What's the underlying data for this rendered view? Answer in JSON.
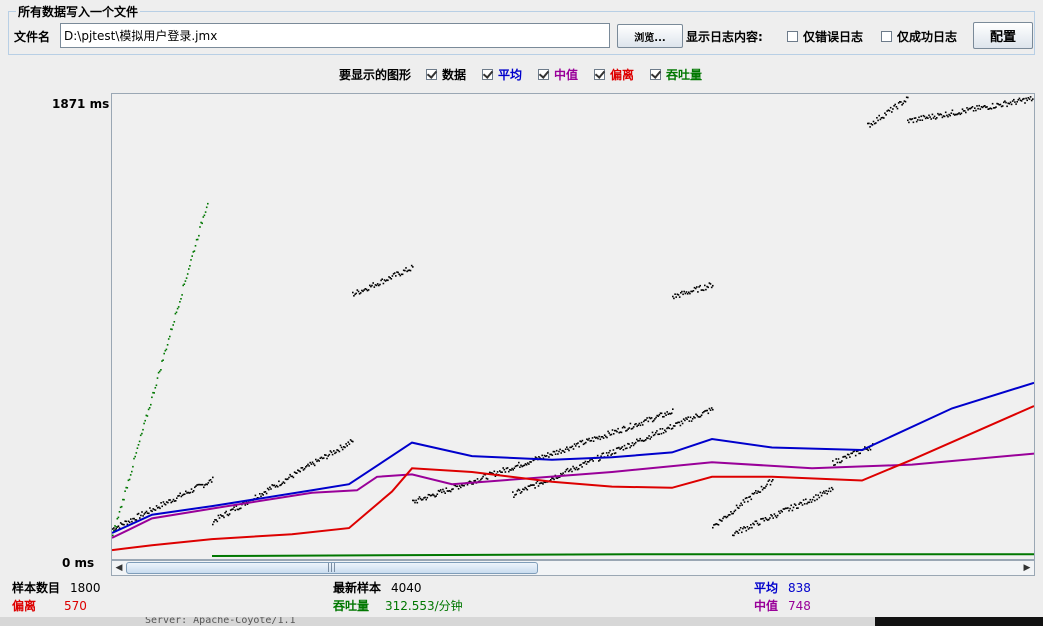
{
  "file_section": {
    "title": "所有数据写入一个文件",
    "filename_label": "文件名",
    "filename_value": "D:\\pjtest\\模拟用户登录.jmx",
    "browse_button": "浏览...",
    "log_label": "显示日志内容:",
    "errors_only": "仅错误日志",
    "success_only": "仅成功日志",
    "config_button": "配置"
  },
  "graph_options": {
    "label": "要显示的图形",
    "items": [
      {
        "label": "数据",
        "checked": true,
        "color": "#000000"
      },
      {
        "label": "平均",
        "checked": true,
        "color": "#0000cc"
      },
      {
        "label": "中值",
        "checked": true,
        "color": "#990099"
      },
      {
        "label": "偏离",
        "checked": true,
        "color": "#dd0000"
      },
      {
        "label": "吞吐量",
        "checked": true,
        "color": "#007700"
      }
    ]
  },
  "chart": {
    "y_max_label": "1871  ms",
    "y_min_label": "0  ms"
  },
  "chart_data": {
    "type": "scatter",
    "ylim": [
      0,
      1871
    ],
    "y_unit": "ms",
    "series": [
      {
        "name": "数据",
        "color": "#000000",
        "segments": [
          {
            "x": [
              0,
              100
            ],
            "y": [
              110,
              310
            ]
          },
          {
            "x": [
              100,
              240
            ],
            "y": [
              140,
              470
            ]
          },
          {
            "x": [
              240,
              300
            ],
            "y": [
              1070,
              1180
            ]
          },
          {
            "x": [
              300,
              560
            ],
            "y": [
              220,
              590
            ]
          },
          {
            "x": [
              400,
              600
            ],
            "y": [
              250,
              600
            ]
          },
          {
            "x": [
              560,
              600
            ],
            "y": [
              1060,
              1110
            ]
          },
          {
            "x": [
              600,
              660
            ],
            "y": [
              120,
              310
            ]
          },
          {
            "x": [
              620,
              720
            ],
            "y": [
              90,
              270
            ]
          },
          {
            "x": [
              720,
              760
            ],
            "y": [
              380,
              450
            ]
          },
          {
            "x": [
              755,
              795
            ],
            "y": [
              1760,
              1871
            ]
          },
          {
            "x": [
              795,
              920
            ],
            "y": [
              1780,
              1871
            ]
          }
        ]
      },
      {
        "name": "吞吐量",
        "color": "#007700",
        "segments": [
          {
            "x": [
              0,
              95
            ],
            "y": [
              80,
              1450
            ]
          }
        ]
      },
      {
        "name": "平均",
        "color": "#0000cc",
        "points": [
          [
            0,
            90
          ],
          [
            40,
            165
          ],
          [
            100,
            200
          ],
          [
            200,
            265
          ],
          [
            237,
            290
          ],
          [
            300,
            460
          ],
          [
            360,
            405
          ],
          [
            440,
            390
          ],
          [
            500,
            400
          ],
          [
            560,
            420
          ],
          [
            600,
            475
          ],
          [
            660,
            440
          ],
          [
            750,
            430
          ],
          [
            840,
            600
          ],
          [
            922,
            705
          ]
        ]
      },
      {
        "name": "中值",
        "color": "#990099",
        "points": [
          [
            0,
            70
          ],
          [
            40,
            150
          ],
          [
            100,
            190
          ],
          [
            200,
            255
          ],
          [
            245,
            265
          ],
          [
            265,
            320
          ],
          [
            300,
            330
          ],
          [
            340,
            290
          ],
          [
            420,
            315
          ],
          [
            500,
            340
          ],
          [
            600,
            380
          ],
          [
            700,
            355
          ],
          [
            800,
            370
          ],
          [
            922,
            415
          ]
        ]
      },
      {
        "name": "偏离",
        "color": "#dd0000",
        "points": [
          [
            0,
            20
          ],
          [
            40,
            40
          ],
          [
            100,
            65
          ],
          [
            180,
            85
          ],
          [
            237,
            110
          ],
          [
            280,
            260
          ],
          [
            300,
            355
          ],
          [
            360,
            340
          ],
          [
            440,
            300
          ],
          [
            500,
            280
          ],
          [
            560,
            275
          ],
          [
            600,
            320
          ],
          [
            660,
            320
          ],
          [
            750,
            305
          ],
          [
            800,
            390
          ],
          [
            922,
            610
          ]
        ]
      }
    ]
  },
  "stats": {
    "samples_label": "样本数目",
    "samples_value": "1800",
    "latest_label": "最新样本",
    "latest_value": "4040",
    "average_label": "平均",
    "average_value": "838",
    "deviation_label": "偏离",
    "deviation_value": "570",
    "throughput_label": "吞吐量",
    "throughput_value": "312.553/分钟",
    "median_label": "中值",
    "median_value": "748"
  },
  "background_text": "Server: Apache-Coyote/1.1"
}
